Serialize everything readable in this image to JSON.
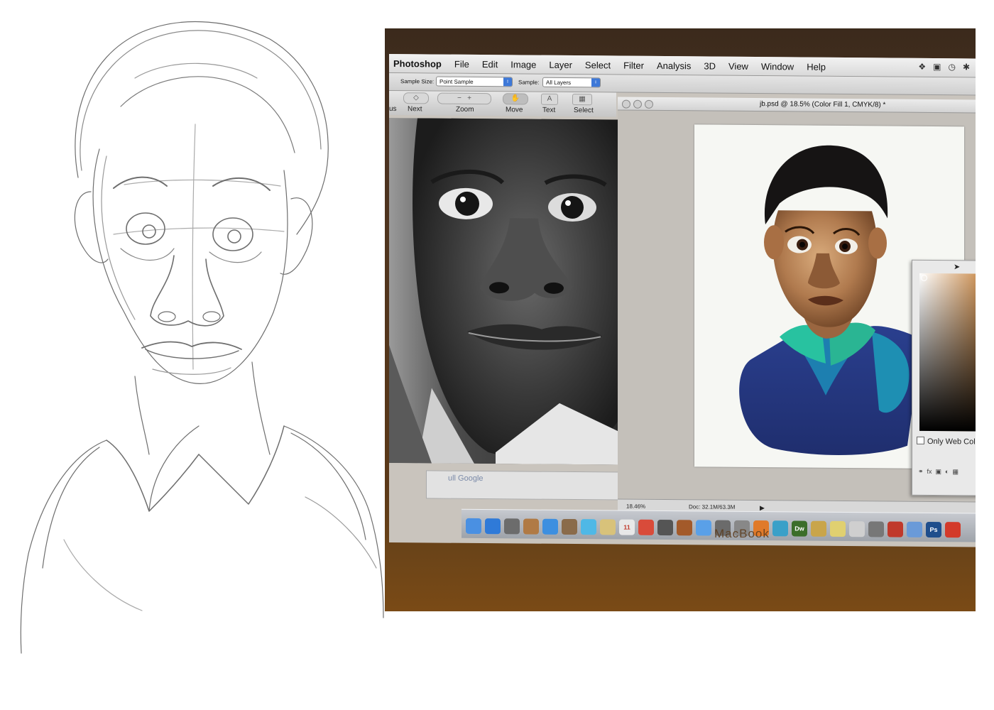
{
  "menubar": {
    "app": "Photoshop",
    "items": [
      "File",
      "Edit",
      "Image",
      "Layer",
      "Select",
      "Filter",
      "Analysis",
      "3D",
      "View",
      "Window",
      "Help"
    ]
  },
  "options": {
    "sample_size_label": "Sample Size:",
    "sample_size_value": "Point Sample",
    "sample_label": "Sample:",
    "sample_value": "All Layers"
  },
  "navbar": {
    "partial": "us",
    "next": "Next",
    "zoom": "Zoom",
    "move": "Move",
    "text": "Text",
    "select": "Select"
  },
  "document": {
    "title": "jb.psd @ 18.5% (Color Fill 1, CMYK/8) *",
    "zoom": "18.46%",
    "doc_size": "Doc: 32.1M/63.3M"
  },
  "color_picker": {
    "only_web_colors": "Only Web Colors"
  },
  "background_window": {
    "text": "ull Google"
  },
  "dock": {
    "items": [
      {
        "icon": "finder-icon",
        "label": "",
        "color": "#4a90e2"
      },
      {
        "icon": "appstore-icon",
        "label": "",
        "color": "#2f7ad8"
      },
      {
        "icon": "clock-icon",
        "label": "",
        "color": "#6c6c6c"
      },
      {
        "icon": "photos-icon",
        "label": "",
        "color": "#b07a45"
      },
      {
        "icon": "safari-icon",
        "label": "",
        "color": "#3d8fe0"
      },
      {
        "icon": "preview-icon",
        "label": "",
        "color": "#8a6b4a"
      },
      {
        "icon": "messages-icon",
        "label": "",
        "color": "#4fb8e6"
      },
      {
        "icon": "notes-icon",
        "label": "",
        "color": "#d8c27a"
      },
      {
        "icon": "calendar-icon",
        "label": "11",
        "color": "#e8e8e8"
      },
      {
        "icon": "chrome-icon",
        "label": "",
        "color": "#d94b3a"
      },
      {
        "icon": "grid-app-icon",
        "label": "",
        "color": "#555555"
      },
      {
        "icon": "guitar-icon",
        "label": "",
        "color": "#a35a2a"
      },
      {
        "icon": "itunes-icon",
        "label": "",
        "color": "#5aa0e8"
      },
      {
        "icon": "dvd-icon",
        "label": "",
        "color": "#6b6b6b"
      },
      {
        "icon": "system-icon",
        "label": "",
        "color": "#888888"
      },
      {
        "icon": "firefox-icon",
        "label": "",
        "color": "#e07a2a"
      },
      {
        "icon": "waves-icon",
        "label": "",
        "color": "#3aa0c8"
      },
      {
        "icon": "dreamweaver-icon",
        "label": "Dw",
        "color": "#3b6e2a"
      },
      {
        "icon": "stamp-icon",
        "label": "",
        "color": "#c9a54a"
      },
      {
        "icon": "bulb-icon",
        "label": "",
        "color": "#e0d070"
      },
      {
        "icon": "document-icon",
        "label": "",
        "color": "#cfcfcf"
      },
      {
        "icon": "camera-icon",
        "label": "",
        "color": "#777777"
      },
      {
        "icon": "acrobat-icon",
        "label": "",
        "color": "#c0392b"
      },
      {
        "icon": "folder-icon",
        "label": "",
        "color": "#6a9ad8"
      },
      {
        "icon": "photoshop-icon",
        "label": "Ps",
        "color": "#1f4e8c"
      },
      {
        "icon": "acrobat-reader-icon",
        "label": "",
        "color": "#d33a2a"
      }
    ]
  },
  "laptop": {
    "brand": "MacBook"
  }
}
